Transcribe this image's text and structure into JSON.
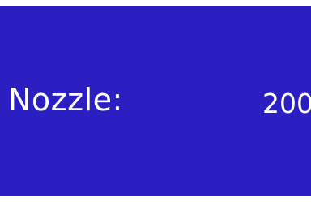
{
  "screen": {
    "background_color": "#2c1fc1",
    "text_color": "#ffffff"
  },
  "nozzle": {
    "label": "Nozzle:",
    "value": "200"
  }
}
